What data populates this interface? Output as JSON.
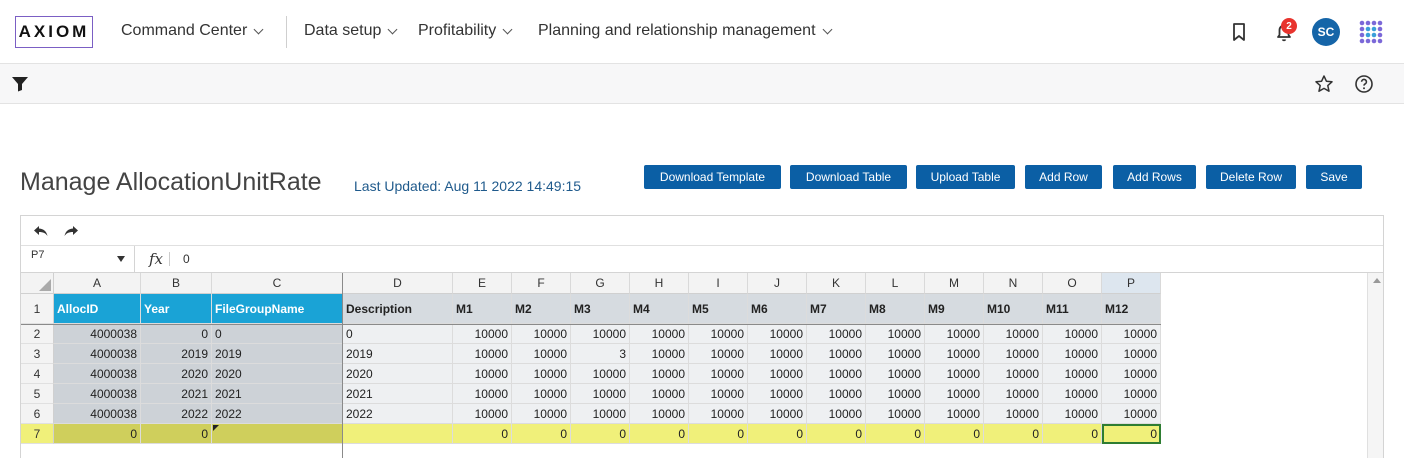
{
  "nav": {
    "logo": "AXIOM",
    "items": [
      {
        "label": "Command Center"
      },
      {
        "label": "Data setup"
      },
      {
        "label": "Profitability"
      },
      {
        "label": "Planning and relationship management"
      }
    ],
    "notification_count": "2",
    "avatar_initials": "SC"
  },
  "page": {
    "title": "Manage AllocationUnitRate",
    "last_updated": "Last Updated: Aug 11 2022 14:49:15"
  },
  "buttons": {
    "download_template": "Download Template",
    "download_table": "Download Table",
    "upload_table": "Upload Table",
    "add_row": "Add Row",
    "add_rows": "Add Rows",
    "delete_row": "Delete Row",
    "save": "Save"
  },
  "sheet": {
    "name_box": "P7",
    "fx_label": "fx",
    "formula_value": "0",
    "columns": [
      "A",
      "B",
      "C",
      "D",
      "E",
      "F",
      "G",
      "H",
      "I",
      "J",
      "K",
      "L",
      "M",
      "N",
      "O",
      "P"
    ],
    "selected_column": "P",
    "row_numbers": [
      "1",
      "2",
      "3",
      "4",
      "5",
      "6",
      "7"
    ],
    "headers": [
      "AllocID",
      "Year",
      "FileGroupName",
      "Description",
      "M1",
      "M2",
      "M3",
      "M4",
      "M5",
      "M6",
      "M7",
      "M8",
      "M9",
      "M10",
      "M11",
      "M12"
    ],
    "rows": [
      [
        "4000038",
        "0",
        "0",
        "0",
        "10000",
        "10000",
        "10000",
        "10000",
        "10000",
        "10000",
        "10000",
        "10000",
        "10000",
        "10000",
        "10000",
        "10000"
      ],
      [
        "4000038",
        "2019",
        "2019",
        "2019",
        "10000",
        "10000",
        "3",
        "10000",
        "10000",
        "10000",
        "10000",
        "10000",
        "10000",
        "10000",
        "10000",
        "10000"
      ],
      [
        "4000038",
        "2020",
        "2020",
        "2020",
        "10000",
        "10000",
        "10000",
        "10000",
        "10000",
        "10000",
        "10000",
        "10000",
        "10000",
        "10000",
        "10000",
        "10000"
      ],
      [
        "4000038",
        "2021",
        "2021",
        "2021",
        "10000",
        "10000",
        "10000",
        "10000",
        "10000",
        "10000",
        "10000",
        "10000",
        "10000",
        "10000",
        "10000",
        "10000"
      ],
      [
        "4000038",
        "2022",
        "2022",
        "2022",
        "10000",
        "10000",
        "10000",
        "10000",
        "10000",
        "10000",
        "10000",
        "10000",
        "10000",
        "10000",
        "10000",
        "10000"
      ],
      [
        "0",
        "0",
        "",
        "",
        "0",
        "0",
        "0",
        "0",
        "0",
        "0",
        "0",
        "0",
        "0",
        "0",
        "0",
        "0"
      ]
    ],
    "active_cell": "P7",
    "highlight_row": "7"
  },
  "colors": {
    "accent": "#0b5fa5",
    "header_cyan": "#1aa3d6",
    "highlight_yellow": "#f0f07a",
    "badge_red": "#e8342e"
  }
}
